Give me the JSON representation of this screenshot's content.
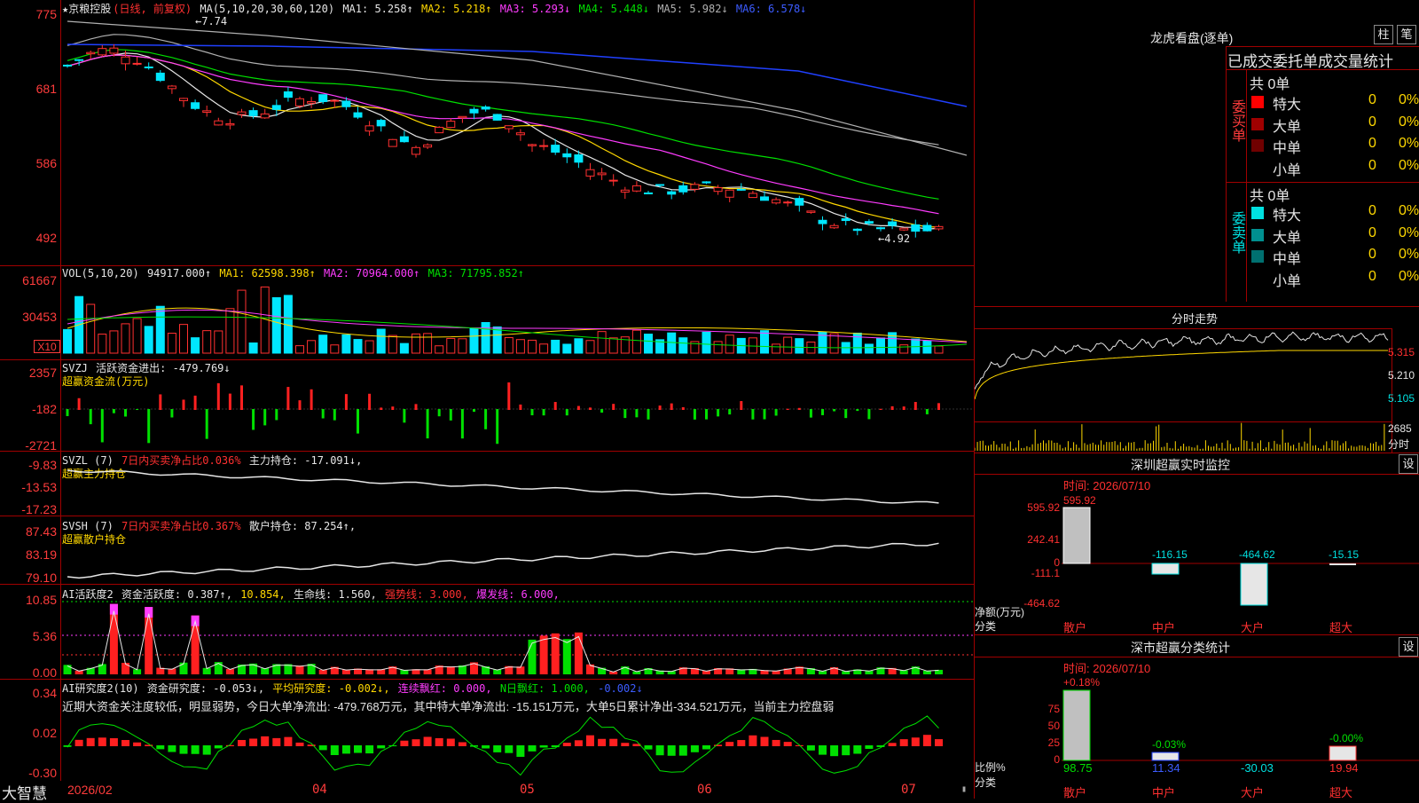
{
  "main_chart": {
    "header": {
      "stock": "★京粮控股",
      "period": "(日线, 前复权)",
      "ma_label": "MA(5,10,20,30,60,120)",
      "ma1": "MA1: 5.258↑",
      "ma2": "MA2: 5.218↑",
      "ma3": "MA3: 5.293↓",
      "ma4": "MA4: 5.448↓",
      "ma5": "MA5: 5.982↓",
      "ma6": "MA6: 6.578↓"
    },
    "y_ticks": [
      "775",
      "681",
      "586",
      "492"
    ],
    "high_marker": "←7.74",
    "low_marker": "←4.92"
  },
  "vol_panel": {
    "header": {
      "label": "VOL(5,10,20)",
      "value": "94917.000↑",
      "ma1": "MA1: 62598.398↑",
      "ma2": "MA2: 70964.000↑",
      "ma3": "MA3: 71795.852↑"
    },
    "y_ticks": [
      "61667",
      "30453"
    ],
    "unit": "X10"
  },
  "svzj_panel": {
    "header": {
      "label": "SVZJ",
      "title": "活跃资金进出: -479.769↓",
      "sub": "超赢资金流(万元)"
    },
    "y_ticks": [
      "2357",
      "-182",
      "-2721"
    ]
  },
  "svzl_panel": {
    "header": {
      "label": "SVZL (7)",
      "red": "7日内买卖净占比0.036%",
      "white": "主力持仓: -17.091↓,",
      "sub": "超赢主力持仓"
    },
    "y_ticks": [
      "-9.83",
      "-13.53",
      "-17.23"
    ]
  },
  "svsh_panel": {
    "header": {
      "label": "SVSH (7)",
      "red": "7日内买卖净占比0.367%",
      "white": "散户持仓: 87.254↑,",
      "sub": "超赢散户持仓"
    },
    "y_ticks": [
      "87.43",
      "83.19",
      "79.10"
    ]
  },
  "ai_panel": {
    "header": {
      "label": "AI活跃度2",
      "active": "资金活跃度: 0.387↑,",
      "v2": "10.854,",
      "life": "生命线: 1.560,",
      "strong": "强势线: 3.000,",
      "burst": "爆发线: 6.000,"
    },
    "y_ticks": [
      "10.85",
      "5.36",
      "0.00"
    ]
  },
  "research_panel": {
    "header": {
      "label": "AI研究度2(10)",
      "research": "资金研究度: -0.053↓,",
      "avg": "平均研究度: -0.002↓,",
      "cont": "连续飘红: 0.000,",
      "nday": "N日飘红: 1.000,",
      "last": "-0.002↓"
    },
    "text": "近期大资金关注度较低，明显弱势，今日大单净流出: -479.768万元，其中特大单净流出: -15.151万元，大单5日累计净出-334.521万元，当前主力控盘弱",
    "y_ticks": [
      "0.34",
      "0.02",
      "-0.30"
    ]
  },
  "x_axis": {
    "labels": [
      "2026/02",
      "04",
      "05",
      "06",
      "07"
    ]
  },
  "brand": "大智慧",
  "right_panel": {
    "title": "龙虎看盘(逐单)",
    "btn1": "柱",
    "btn2": "笔",
    "tabs": [
      "已成交",
      "委托单",
      "成交量统计"
    ],
    "buy": {
      "label": "委买单",
      "total": "共 0单",
      "rows": [
        {
          "name": "特大",
          "count": "0",
          "pct": "0%",
          "color": "#ff0000"
        },
        {
          "name": "大单",
          "count": "0",
          "pct": "0%",
          "color": "#a00000"
        },
        {
          "name": "中单",
          "count": "0",
          "pct": "0%",
          "color": "#700000"
        },
        {
          "name": "小单",
          "count": "0",
          "pct": "0%",
          "color": "#000000"
        }
      ]
    },
    "sell": {
      "label": "委卖单",
      "total": "共 0单",
      "rows": [
        {
          "name": "特大",
          "count": "0",
          "pct": "0%",
          "color": "#00e0e0"
        },
        {
          "name": "大单",
          "count": "0",
          "pct": "0%",
          "color": "#009090"
        },
        {
          "name": "中单",
          "count": "0",
          "pct": "0%",
          "color": "#007070"
        },
        {
          "name": "小单",
          "count": "0",
          "pct": "0%",
          "color": "#000000"
        }
      ]
    },
    "intraday": {
      "title": "分时走势",
      "prices": [
        "5.315",
        "5.210",
        "5.105"
      ],
      "vol": "2685",
      "vol_label": "分时"
    },
    "sz_monitor": {
      "title": "深圳超赢实时监控",
      "settings": "设",
      "time": "时间: 2026/07/10",
      "y_ticks": [
        "595.92",
        "242.41",
        "0",
        "-111.1",
        "-464.62"
      ],
      "values": [
        "595.92",
        "-116.15",
        "-464.62",
        "-15.15"
      ],
      "unit": "净额(万元)",
      "cat_label": "分类",
      "cats": [
        "散户",
        "中户",
        "大户",
        "超大"
      ]
    },
    "sz_stats": {
      "title": "深市超赢分类统计",
      "settings": "设",
      "time": "时间: 2026/07/10",
      "y_ticks": [
        "75",
        "50",
        "25",
        "0"
      ],
      "tops": [
        "+0.18%",
        "-0.03%",
        "-0.00%"
      ],
      "values": [
        "98.75",
        "11.34",
        "-30.03",
        "19.94"
      ],
      "unit": "比例%",
      "cat_label": "分类",
      "cats": [
        "散户",
        "中户",
        "大户",
        "超大"
      ]
    }
  }
}
